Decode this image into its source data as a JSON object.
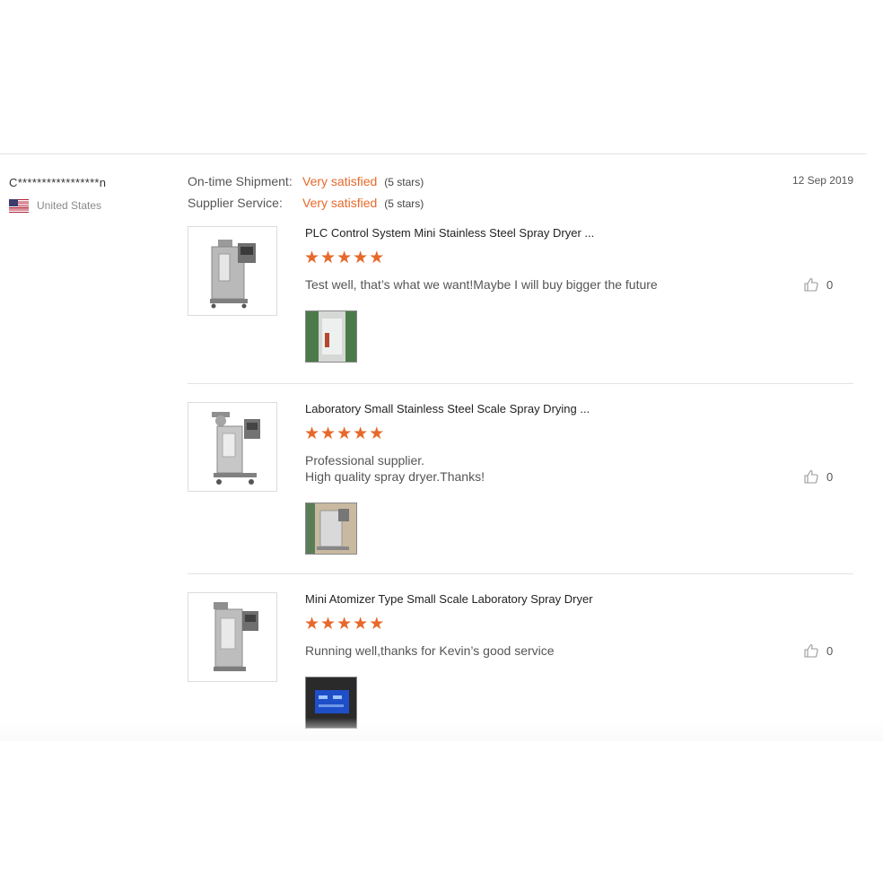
{
  "buyer": {
    "name": "C*****************n",
    "country": "United States"
  },
  "ratings": {
    "ontime_label": "On-time Shipment:",
    "ontime_value": "Very satisfied",
    "ontime_stars": "(5 stars)",
    "service_label": "Supplier Service:",
    "service_value": "Very satisfied",
    "service_stars": "(5 stars)",
    "date": "12 Sep 2019"
  },
  "products": [
    {
      "title": "PLC Control System Mini Stainless Steel Spray Dryer ...",
      "stars": 5,
      "comment_lines": [
        "Test well, that’s what we want!Maybe I will buy bigger the future"
      ],
      "likes": "0"
    },
    {
      "title": "Laboratory Small Stainless Steel Scale Spray Drying ...",
      "stars": 5,
      "comment_lines": [
        "Professional supplier.",
        "High quality spray dryer.Thanks!"
      ],
      "likes": "0"
    },
    {
      "title": "Mini Atomizer Type Small Scale Laboratory Spray Dryer",
      "stars": 5,
      "comment_lines": [
        "Running well,thanks for Kevin’s good service"
      ],
      "likes": "0"
    }
  ],
  "colors": {
    "accent": "#e6692a",
    "divider": "#e3e3e3"
  },
  "icons": {
    "like": "thumbs-up-icon",
    "star": "star-icon",
    "flag": "us-flag-icon"
  }
}
